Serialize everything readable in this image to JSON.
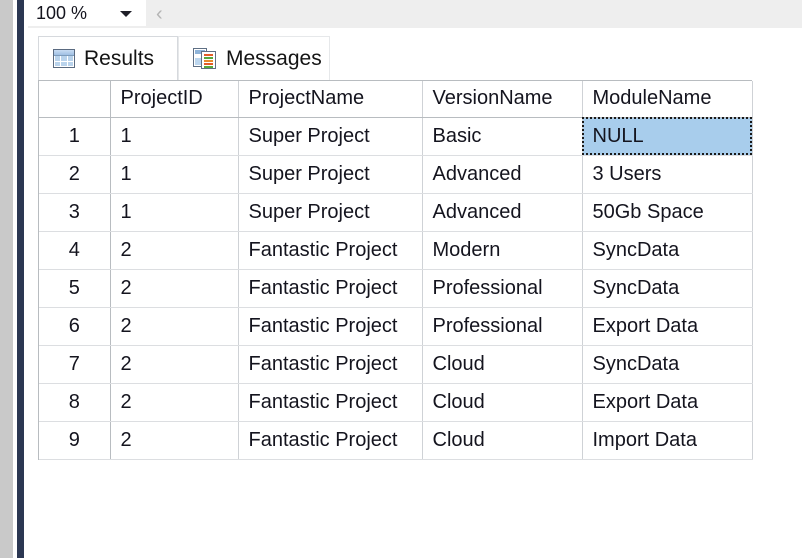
{
  "zoombar": {
    "zoom_value": "100 %",
    "zoom_icon": "chevron-down-icon",
    "nav_back_chevron": "‹"
  },
  "tabs": [
    {
      "label": "Results",
      "icon": "results-grid-icon",
      "active": true
    },
    {
      "label": "Messages",
      "icon": "messages-report-icon",
      "active": false
    }
  ],
  "grid": {
    "row_header_label": "",
    "columns": [
      "ProjectID",
      "ProjectName",
      "VersionName",
      "ModuleName"
    ],
    "rows": [
      {
        "n": "1",
        "ProjectID": "1",
        "ProjectName": "Super Project",
        "VersionName": "Basic",
        "ModuleName": "NULL"
      },
      {
        "n": "2",
        "ProjectID": "1",
        "ProjectName": "Super Project",
        "VersionName": "Advanced",
        "ModuleName": "3 Users"
      },
      {
        "n": "3",
        "ProjectID": "1",
        "ProjectName": "Super Project",
        "VersionName": "Advanced",
        "ModuleName": "50Gb Space"
      },
      {
        "n": "4",
        "ProjectID": "2",
        "ProjectName": "Fantastic Project",
        "VersionName": "Modern",
        "ModuleName": "SyncData"
      },
      {
        "n": "5",
        "ProjectID": "2",
        "ProjectName": "Fantastic Project",
        "VersionName": "Professional",
        "ModuleName": "SyncData"
      },
      {
        "n": "6",
        "ProjectID": "2",
        "ProjectName": "Fantastic Project",
        "VersionName": "Professional",
        "ModuleName": "Export Data"
      },
      {
        "n": "7",
        "ProjectID": "2",
        "ProjectName": "Fantastic Project",
        "VersionName": "Cloud",
        "ModuleName": "SyncData"
      },
      {
        "n": "8",
        "ProjectID": "2",
        "ProjectName": "Fantastic Project",
        "VersionName": "Cloud",
        "ModuleName": "Export Data"
      },
      {
        "n": "9",
        "ProjectID": "2",
        "ProjectName": "Fantastic Project",
        "VersionName": "Cloud",
        "ModuleName": "Import Data"
      }
    ],
    "selected_cell": {
      "row": 1,
      "column": "ModuleName",
      "value": "NULL"
    }
  },
  "colors": {
    "selection_fill": "#a8cdec",
    "gutter_gray": "#c9c9c9",
    "gutter_navy": "#2b3752",
    "toolbar_bg": "#eeeeee",
    "grid_line": "#dcdee1",
    "text": "#14141e"
  }
}
